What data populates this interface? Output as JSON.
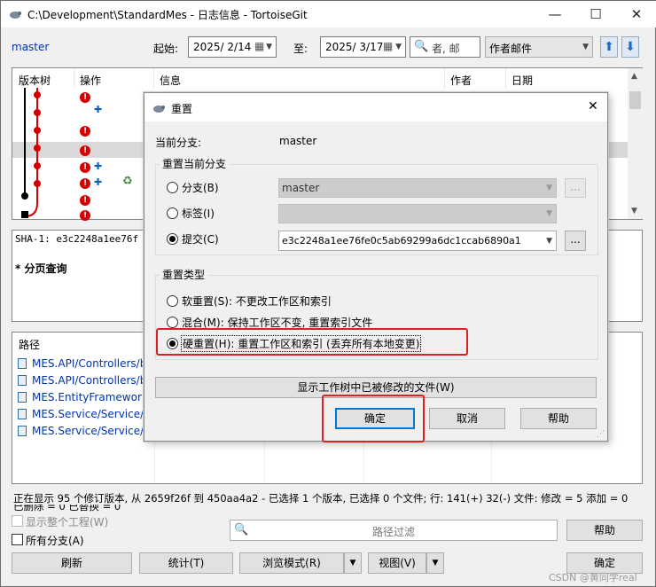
{
  "window": {
    "title": "C:\\Development\\StandardMes - 日志信息 - TortoiseGit",
    "minimize": "—",
    "maximize": "☐",
    "close": "✕"
  },
  "toolbar": {
    "branch": "master",
    "from_label": "起始:",
    "from_date": "2025/  2/14",
    "to_label": "至:",
    "to_date": "2025/  3/17",
    "search_placeholder": "者, 邮",
    "filter_field": "作者邮件"
  },
  "log_table": {
    "columns": [
      "版本树",
      "操作",
      "信息",
      "作者",
      "日期"
    ]
  },
  "detail": {
    "sha": "SHA-1: e3c2248a1ee76f",
    "subject": "*  分页查询"
  },
  "files": {
    "header": "路径",
    "rows": [
      "MES.API/Controllers/ba",
      "MES.API/Controllers/ba",
      "MES.EntityFrameworkC",
      "MES.Service/Service/ba",
      "MES.Service/Service/ba"
    ]
  },
  "statusbar": {
    "line1": "正在显示 95 个修订版本, 从 2659f26f 到 450aa4a2 - 已选择 1 个版本, 已选择 0 个文件; 行: 141(+) 32(-) 文件: 修改 = 5 添加 = 0",
    "line2": "已删除 = 0 已替换 = 0"
  },
  "bottom": {
    "show_whole_project": "显示整个工程(W)",
    "all_branches": "所有分支(A)",
    "path_filter_placeholder": "路径过滤",
    "help": "帮助",
    "refresh": "刷新",
    "stats": "统计(T)",
    "browse_mode": "浏览模式(R)",
    "view": "视图(V)",
    "ok": "确定"
  },
  "dialog": {
    "title": "重置",
    "current_branch_label": "当前分支:",
    "current_branch_value": "master",
    "reset_group_label": "重置当前分支",
    "option_branch": "分支(B)",
    "option_tag": "标签(I)",
    "option_commit": "提交(C)",
    "branch_value": "master",
    "tag_value": "",
    "commit_value": "e3c2248a1ee76fe0c5ab69299a6dc1ccab6890a1",
    "browse": "...",
    "reset_type_label": "重置类型",
    "soft": "软重置(S): 不更改工作区和索引",
    "mixed": "混合(M): 保持工作区不变, 重置索引文件",
    "hard": "硬重置(H): 重置工作区和索引 (丢弃所有本地变更)",
    "show_modified": "显示工作树中已被修改的文件(W)",
    "ok": "确定",
    "cancel": "取消",
    "help": "帮助",
    "close": "✕"
  },
  "watermark": "CSDN @黄同学real",
  "colors": {
    "accent": "#0078d7",
    "highlight": "#e02020",
    "graph": "#d40000",
    "link": "#0033aa"
  }
}
